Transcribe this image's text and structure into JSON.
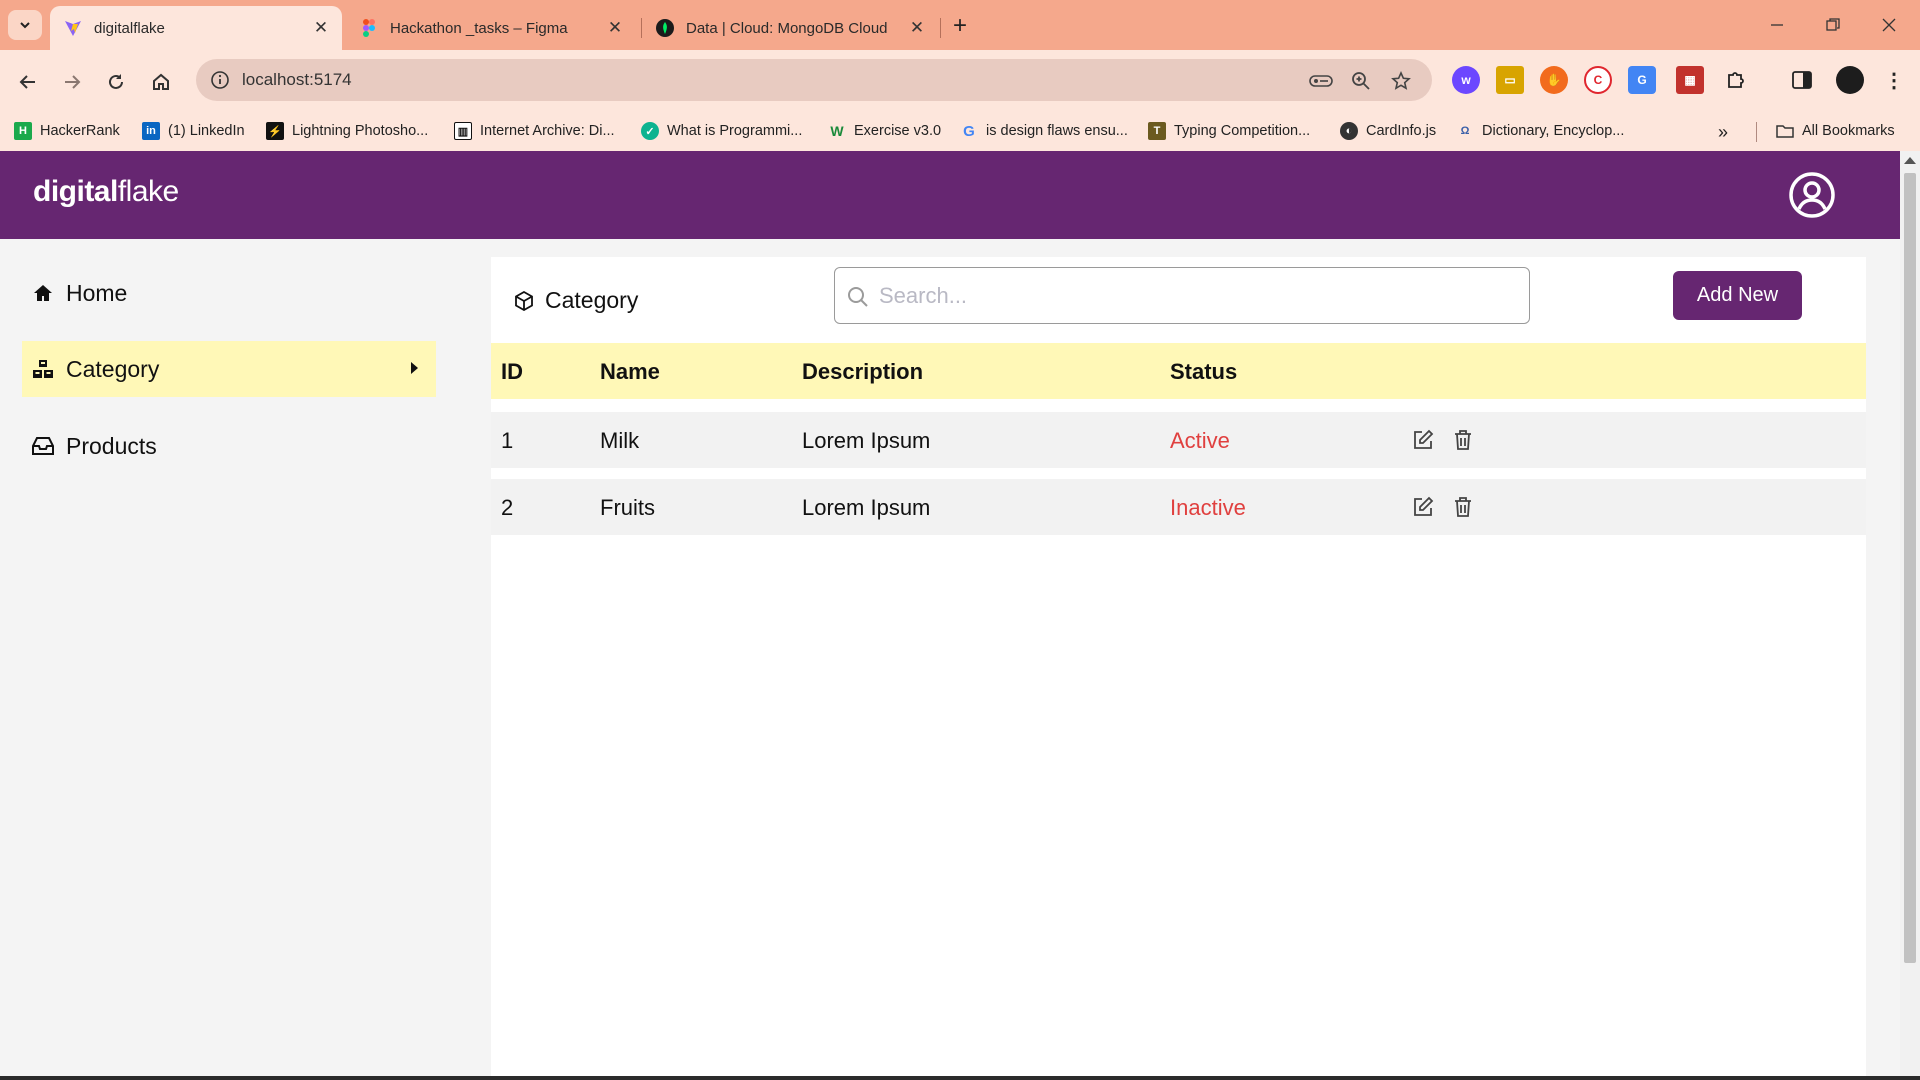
{
  "browser": {
    "tabs": [
      {
        "title": "digitalflake",
        "icon": "vite-icon",
        "active": true
      },
      {
        "title": "Hackathon _tasks – Figma",
        "icon": "figma-icon",
        "active": false
      },
      {
        "title": "Data | Cloud: MongoDB Cloud",
        "icon": "mongodb-leaf-icon",
        "active": false
      }
    ],
    "url": "localhost:5174",
    "bookmarks": [
      {
        "label": "HackerRank",
        "icon": "hackerrank-icon"
      },
      {
        "label": "(1) LinkedIn",
        "icon": "linkedin-icon"
      },
      {
        "label": "Lightning Photosho...",
        "icon": "lightning-icon"
      },
      {
        "label": "Internet Archive: Di...",
        "icon": "archive-icon"
      },
      {
        "label": "What is Programmi...",
        "icon": "shield-icon"
      },
      {
        "label": "Exercise v3.0",
        "icon": "w-icon"
      },
      {
        "label": "is design flaws ensu...",
        "icon": "google-icon"
      },
      {
        "label": "Typing Competition...",
        "icon": "typing-icon"
      },
      {
        "label": "CardInfo.js",
        "icon": "globe-icon"
      },
      {
        "label": "Dictionary, Encyclop...",
        "icon": "dictionary-icon"
      }
    ],
    "all_bookmarks": "All Bookmarks"
  },
  "app": {
    "logo_bold": "digital",
    "logo_light": "flake",
    "sidebar": {
      "items": [
        {
          "label": "Home",
          "icon": "home-icon"
        },
        {
          "label": "Category",
          "icon": "category-icon",
          "active": true
        },
        {
          "label": "Products",
          "icon": "inbox-icon"
        }
      ]
    },
    "panel": {
      "title": "Category",
      "search_placeholder": "Search...",
      "add_button": "Add New"
    },
    "table": {
      "columns": [
        "ID",
        "Name",
        "Description",
        "Status"
      ],
      "rows": [
        {
          "id": "1",
          "name": "Milk",
          "description": "Lorem Ipsum",
          "status": "Active"
        },
        {
          "id": "2",
          "name": "Fruits",
          "description": "Lorem Ipsum",
          "status": "Inactive"
        }
      ]
    }
  },
  "colors": {
    "brand": "#662671",
    "highlight": "#fff8b7",
    "status": "#e0403f",
    "tabbar": "#f5a88c"
  }
}
